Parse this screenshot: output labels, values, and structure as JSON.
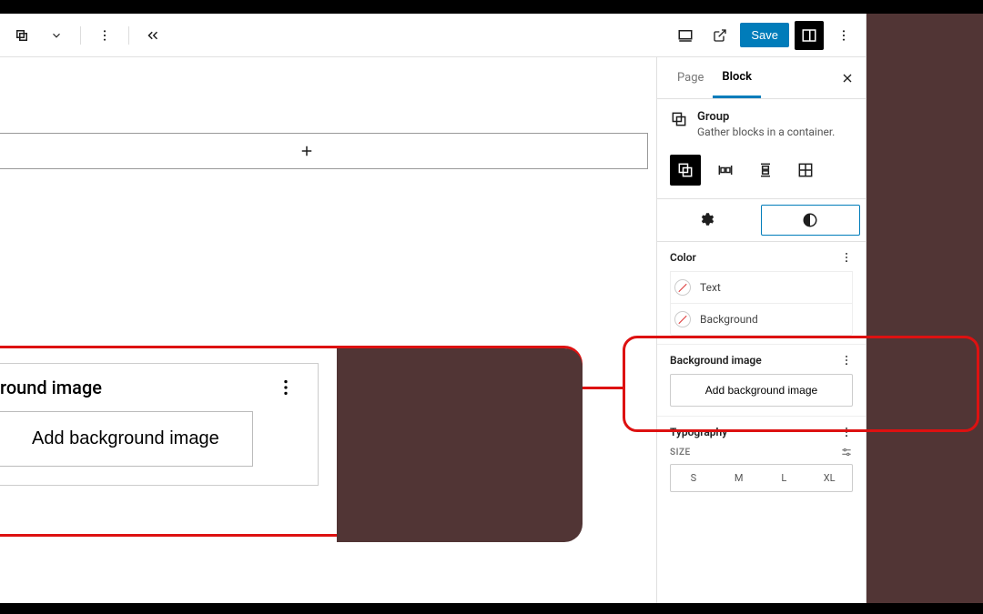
{
  "top": {
    "save": "Save"
  },
  "tabs": {
    "page": "Page",
    "block": "Block"
  },
  "block": {
    "name": "Group",
    "desc": "Gather blocks in a container."
  },
  "color": {
    "heading": "Color",
    "text": "Text",
    "background": "Background"
  },
  "bgimg": {
    "heading": "Background image",
    "button": "Add background image"
  },
  "typo": {
    "heading": "Typography",
    "size_label": "SIZE",
    "sizes": [
      "S",
      "M",
      "L",
      "XL"
    ]
  },
  "canvas": {
    "title_fragment": "ge"
  },
  "zoom": {
    "heading": "round image",
    "button": "Add background image"
  }
}
